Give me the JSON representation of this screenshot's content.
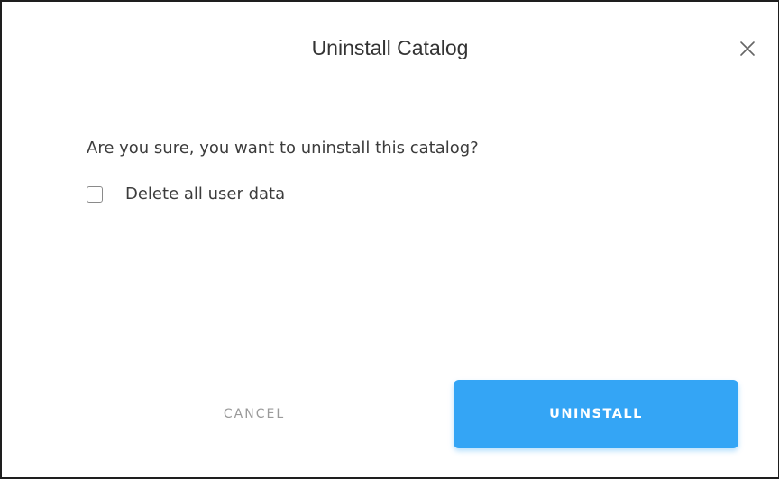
{
  "dialog": {
    "title": "Uninstall Catalog",
    "close_icon": "close-icon",
    "message": "Are you sure, you want to uninstall this catalog?",
    "checkbox": {
      "label": "Delete all user data",
      "checked": false
    },
    "buttons": {
      "cancel_label": "CANCEL",
      "confirm_label": "UNINSTALL"
    }
  },
  "colors": {
    "primary": "#34a5f5",
    "text": "#3c3c3c",
    "muted": "#9a9a9a",
    "border": "#1e1e1e"
  }
}
